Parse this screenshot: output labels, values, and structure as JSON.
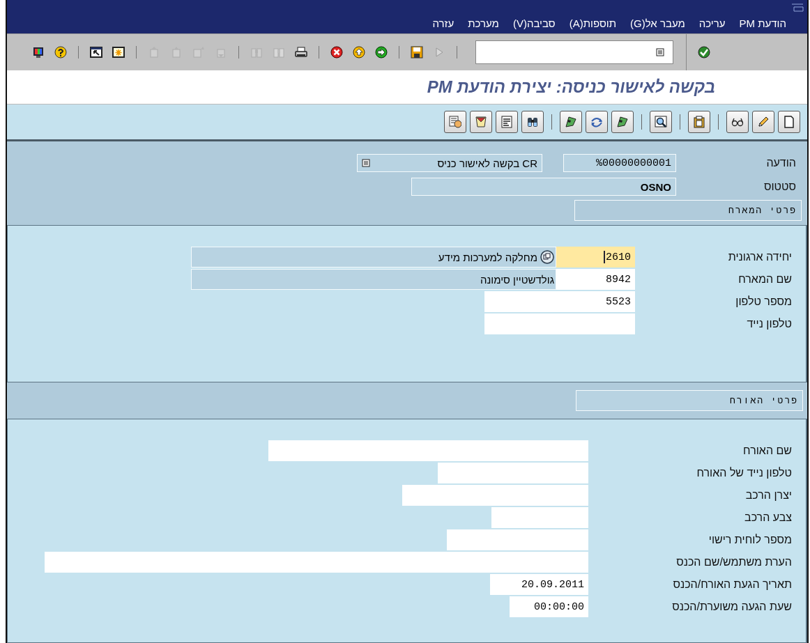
{
  "menu": [
    "הודעת PM",
    "עריכה",
    "מעבר אל(G)",
    "תוספות(A)",
    "סביבה(V)",
    "מערכת",
    "עזרה"
  ],
  "system_toolbar": [
    {
      "kind": "screen",
      "disabled": false
    },
    {
      "kind": "help",
      "disabled": false
    },
    {
      "kind": "separator"
    },
    {
      "kind": "select",
      "disabled": false
    },
    {
      "kind": "new",
      "disabled": false
    },
    {
      "kind": "separator"
    },
    {
      "kind": "first",
      "disabled": true
    },
    {
      "kind": "prev",
      "disabled": true
    },
    {
      "kind": "next",
      "disabled": true
    },
    {
      "kind": "last",
      "disabled": true
    },
    {
      "kind": "separator"
    },
    {
      "kind": "find",
      "disabled": true
    },
    {
      "kind": "findnext",
      "disabled": true
    },
    {
      "kind": "print",
      "disabled": false
    },
    {
      "kind": "separator"
    },
    {
      "kind": "cancel",
      "disabled": false
    },
    {
      "kind": "exit",
      "disabled": false
    },
    {
      "kind": "back",
      "disabled": false
    },
    {
      "kind": "separator"
    },
    {
      "kind": "save",
      "disabled": false
    },
    {
      "kind": "more",
      "disabled": true
    }
  ],
  "title": "בקשה לאישור כניסה: יצירת הודעת PM",
  "app_toolbar": [
    {
      "kind": "palette"
    },
    {
      "kind": "scroll"
    },
    {
      "kind": "list"
    },
    {
      "kind": "binoculars"
    },
    {
      "kind": "separator"
    },
    {
      "kind": "flag"
    },
    {
      "kind": "arrows"
    },
    {
      "kind": "flag"
    },
    {
      "kind": "separator"
    },
    {
      "kind": "magnifier"
    },
    {
      "kind": "separator"
    },
    {
      "kind": "clipboard"
    },
    {
      "kind": "separator"
    },
    {
      "kind": "glasses"
    },
    {
      "kind": "pencil"
    },
    {
      "kind": "page"
    }
  ],
  "header": {
    "notification": {
      "label": "הודעה",
      "value": "%00000000001",
      "description": "CR בקשה לאישור כניס"
    },
    "status": {
      "label": "סטטוס",
      "value": "OSNO"
    }
  },
  "sections": [
    {
      "title": "פרטי המארח",
      "fields": [
        {
          "label": "יחידה ארגונית",
          "value": "2610",
          "description": "מחלקה למערכות מידע",
          "focused": true
        },
        {
          "label": "שם המארח",
          "value": "8942",
          "description": "גולדשטיין סימונה",
          "focused": false
        },
        {
          "label": "מספר טלפון",
          "value": "5523",
          "focused": false
        },
        {
          "label": "טלפון נייד",
          "focused": false
        }
      ]
    },
    {
      "title": "פרטי האורח",
      "fields": [
        {
          "label": "שם האורח",
          "focused": false
        },
        {
          "label": "טלפון נייד של האורח",
          "focused": false
        },
        {
          "label": "יצרן הרכב",
          "focused": false
        },
        {
          "label": "צבע הרכב",
          "focused": false
        },
        {
          "label": "מספר לוחית רישוי",
          "focused": false
        },
        {
          "label": "הערת משתמש/שם הכנס",
          "focused": false
        },
        {
          "label": "תאריך הגעת האורח/הכנס",
          "value": "20.09.2011",
          "focused": false
        },
        {
          "label": "שעת הגעה משוערת/הכנס",
          "value": "00:00:00",
          "focused": false
        }
      ]
    }
  ]
}
